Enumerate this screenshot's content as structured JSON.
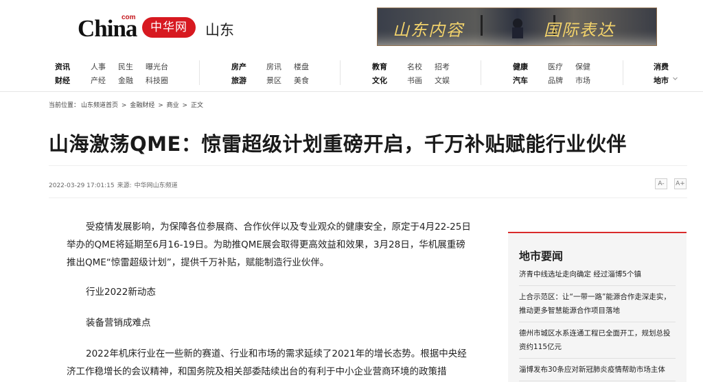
{
  "header": {
    "logo_china": "China",
    "logo_com": "com",
    "logo_zh": "中华网",
    "region": "山东",
    "banner_text_left": "山东内容",
    "banner_text_right": "国际表达"
  },
  "nav": [
    {
      "row1": {
        "cat": "资讯",
        "links": [
          "人事",
          "民生",
          "曝光台"
        ]
      },
      "row2": {
        "cat": "财经",
        "links": [
          "产经",
          "金融",
          "科技圈"
        ]
      }
    },
    {
      "row1": {
        "cat": "房产",
        "links": [
          "房讯",
          "楼盘"
        ]
      },
      "row2": {
        "cat": "旅游",
        "links": [
          "景区",
          "美食"
        ]
      }
    },
    {
      "row1": {
        "cat": "教育",
        "links": [
          "名校",
          "招考"
        ]
      },
      "row2": {
        "cat": "文化",
        "links": [
          "书画",
          "文娱"
        ]
      }
    },
    {
      "row1": {
        "cat": "健康",
        "links": [
          "医疗",
          "保健"
        ]
      },
      "row2": {
        "cat": "汽车",
        "links": [
          "品牌",
          "市场"
        ]
      }
    },
    {
      "row1": {
        "cat": "消费",
        "links": []
      },
      "row2": {
        "cat": "地市",
        "links": []
      }
    }
  ],
  "breadcrumb": {
    "prefix": "当前位置：",
    "items": [
      "山东频道首页",
      "金融财经",
      "商业",
      "正文"
    ],
    "separator": ">"
  },
  "article": {
    "title": "山海激荡QME：惊雷超级计划重磅开启，千万补贴赋能行业伙伴",
    "date": "2022-03-29 17:01:15",
    "source_label": "来源:",
    "source": "中华网山东频道",
    "font_larger": "A+",
    "font_smaller": "A-",
    "paragraphs": [
      "受疫情发展影响，为保障各位参展商、合作伙伴以及专业观众的健康安全，原定于4月22-25日举办的QME将延期至6月16-19日。为助推QME展会取得更高效益和效果，3月28日，华机展重磅推出QME“惊雷超级计划”，提供千万补贴，赋能制造行业伙伴。",
      "行业2022新动态",
      "装备营销成难点",
      "2022年机床行业在一些新的赛道、行业和市场的需求延续了2021年的增长态势。根据中央经济工作稳增长的会议精神，和国务院及相关部委陆续出台的有利于中小企业营商环境的政策措"
    ]
  },
  "sidebar": {
    "title": "地市要闻",
    "items": [
      "济青中线选址走向确定 经过淄博5个镇",
      "上合示范区：让“一带一路”能源合作走深走实，推动更多智慧能源合作项目落地",
      "德州市城区水系连通工程已全面开工，规划总投资约115亿元",
      "淄博发布30条应对新冠肺炎疫情帮助市场主体"
    ]
  },
  "colors": {
    "brand_red": "#d71920",
    "sidebar_accent": "#d92a2a",
    "banner_gold": "#f3d36b"
  }
}
